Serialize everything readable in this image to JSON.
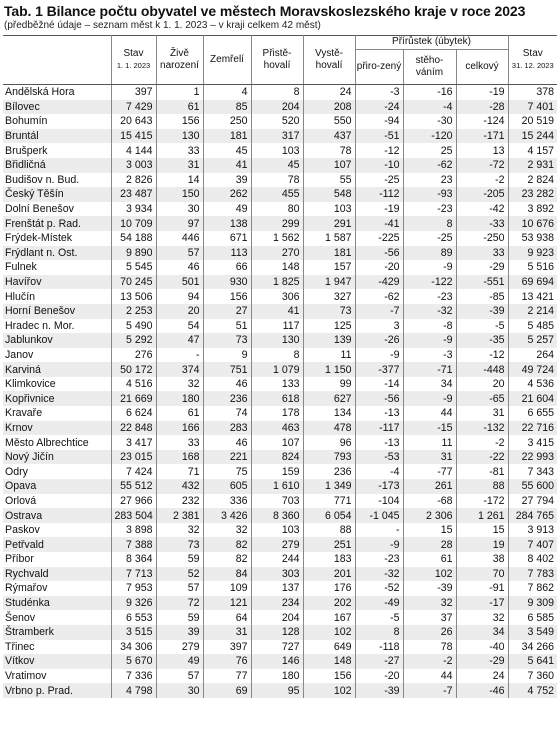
{
  "title": "Tab. 1 Bilance počtu obyvatel ve městech Moravskoslezského kraje v roce 2023",
  "subtitle": "(předběžné údaje – seznam měst k 1. 1. 2023 – v kraji celkem 42 měst)",
  "headers": {
    "stav_start": "Stav",
    "stav_start_date": "1. 1. 2023",
    "zive_narozeni": "Živě narození",
    "zemreli": "Zemřelí",
    "pristehovali": "Přistě-hovalí",
    "vystehovali": "Vystě-hovalí",
    "prirustek": "Přírůstek (úbytek)",
    "prirozeny": "přiro-zený",
    "stehovanim": "stěho-váním",
    "celkovy": "celkový",
    "stav_end": "Stav",
    "stav_end_date": "31. 12. 2023"
  },
  "rows": [
    [
      "Andělská Hora",
      "397",
      "1",
      "4",
      "8",
      "24",
      "-3",
      "-16",
      "-19",
      "378"
    ],
    [
      "Bílovec",
      "7 429",
      "61",
      "85",
      "204",
      "208",
      "-24",
      "-4",
      "-28",
      "7 401"
    ],
    [
      "Bohumín",
      "20 643",
      "156",
      "250",
      "520",
      "550",
      "-94",
      "-30",
      "-124",
      "20 519"
    ],
    [
      "Bruntál",
      "15 415",
      "130",
      "181",
      "317",
      "437",
      "-51",
      "-120",
      "-171",
      "15 244"
    ],
    [
      "Brušperk",
      "4 144",
      "33",
      "45",
      "103",
      "78",
      "-12",
      "25",
      "13",
      "4 157"
    ],
    [
      "Břidličná",
      "3 003",
      "31",
      "41",
      "45",
      "107",
      "-10",
      "-62",
      "-72",
      "2 931"
    ],
    [
      "Budišov n. Bud.",
      "2 826",
      "14",
      "39",
      "78",
      "55",
      "-25",
      "23",
      "-2",
      "2 824"
    ],
    [
      "Český Těšín",
      "23 487",
      "150",
      "262",
      "455",
      "548",
      "-112",
      "-93",
      "-205",
      "23 282"
    ],
    [
      "Dolní Benešov",
      "3 934",
      "30",
      "49",
      "80",
      "103",
      "-19",
      "-23",
      "-42",
      "3 892"
    ],
    [
      "Frenštát p. Rad.",
      "10 709",
      "97",
      "138",
      "299",
      "291",
      "-41",
      "8",
      "-33",
      "10 676"
    ],
    [
      "Frýdek-Místek",
      "54 188",
      "446",
      "671",
      "1 562",
      "1 587",
      "-225",
      "-25",
      "-250",
      "53 938"
    ],
    [
      "Frýdlant n. Ost.",
      "9 890",
      "57",
      "113",
      "270",
      "181",
      "-56",
      "89",
      "33",
      "9 923"
    ],
    [
      "Fulnek",
      "5 545",
      "46",
      "66",
      "148",
      "157",
      "-20",
      "-9",
      "-29",
      "5 516"
    ],
    [
      "Havířov",
      "70 245",
      "501",
      "930",
      "1 825",
      "1 947",
      "-429",
      "-122",
      "-551",
      "69 694"
    ],
    [
      "Hlučín",
      "13 506",
      "94",
      "156",
      "306",
      "327",
      "-62",
      "-23",
      "-85",
      "13 421"
    ],
    [
      "Horní Benešov",
      "2 253",
      "20",
      "27",
      "41",
      "73",
      "-7",
      "-32",
      "-39",
      "2 214"
    ],
    [
      "Hradec n. Mor.",
      "5 490",
      "54",
      "51",
      "117",
      "125",
      "3",
      "-8",
      "-5",
      "5 485"
    ],
    [
      "Jablunkov",
      "5 292",
      "47",
      "73",
      "130",
      "139",
      "-26",
      "-9",
      "-35",
      "5 257"
    ],
    [
      "Janov",
      "276",
      "-",
      "9",
      "8",
      "11",
      "-9",
      "-3",
      "-12",
      "264"
    ],
    [
      "Karviná",
      "50 172",
      "374",
      "751",
      "1 079",
      "1 150",
      "-377",
      "-71",
      "-448",
      "49 724"
    ],
    [
      "Klimkovice",
      "4 516",
      "32",
      "46",
      "133",
      "99",
      "-14",
      "34",
      "20",
      "4 536"
    ],
    [
      "Kopřivnice",
      "21 669",
      "180",
      "236",
      "618",
      "627",
      "-56",
      "-9",
      "-65",
      "21 604"
    ],
    [
      "Kravaře",
      "6 624",
      "61",
      "74",
      "178",
      "134",
      "-13",
      "44",
      "31",
      "6 655"
    ],
    [
      "Krnov",
      "22 848",
      "166",
      "283",
      "463",
      "478",
      "-117",
      "-15",
      "-132",
      "22 716"
    ],
    [
      "Město Albrechtice",
      "3 417",
      "33",
      "46",
      "107",
      "96",
      "-13",
      "11",
      "-2",
      "3 415"
    ],
    [
      "Nový Jičín",
      "23 015",
      "168",
      "221",
      "824",
      "793",
      "-53",
      "31",
      "-22",
      "22 993"
    ],
    [
      "Odry",
      "7 424",
      "71",
      "75",
      "159",
      "236",
      "-4",
      "-77",
      "-81",
      "7 343"
    ],
    [
      "Opava",
      "55 512",
      "432",
      "605",
      "1 610",
      "1 349",
      "-173",
      "261",
      "88",
      "55 600"
    ],
    [
      "Orlová",
      "27 966",
      "232",
      "336",
      "703",
      "771",
      "-104",
      "-68",
      "-172",
      "27 794"
    ],
    [
      "Ostrava",
      "283 504",
      "2 381",
      "3 426",
      "8 360",
      "6 054",
      "-1 045",
      "2 306",
      "1 261",
      "284 765"
    ],
    [
      "Paskov",
      "3 898",
      "32",
      "32",
      "103",
      "88",
      "-",
      "15",
      "15",
      "3 913"
    ],
    [
      "Petřvald",
      "7 388",
      "73",
      "82",
      "279",
      "251",
      "-9",
      "28",
      "19",
      "7 407"
    ],
    [
      "Příbor",
      "8 364",
      "59",
      "82",
      "244",
      "183",
      "-23",
      "61",
      "38",
      "8 402"
    ],
    [
      "Rychvald",
      "7 713",
      "52",
      "84",
      "303",
      "201",
      "-32",
      "102",
      "70",
      "7 783"
    ],
    [
      "Rýmařov",
      "7 953",
      "57",
      "109",
      "137",
      "176",
      "-52",
      "-39",
      "-91",
      "7 862"
    ],
    [
      "Studénka",
      "9 326",
      "72",
      "121",
      "234",
      "202",
      "-49",
      "32",
      "-17",
      "9 309"
    ],
    [
      "Šenov",
      "6 553",
      "59",
      "64",
      "204",
      "167",
      "-5",
      "37",
      "32",
      "6 585"
    ],
    [
      "Štramberk",
      "3 515",
      "39",
      "31",
      "128",
      "102",
      "8",
      "26",
      "34",
      "3 549"
    ],
    [
      "Třinec",
      "34 306",
      "279",
      "397",
      "727",
      "649",
      "-118",
      "78",
      "-40",
      "34 266"
    ],
    [
      "Vítkov",
      "5 670",
      "49",
      "76",
      "146",
      "148",
      "-27",
      "-2",
      "-29",
      "5 641"
    ],
    [
      "Vratimov",
      "7 336",
      "57",
      "77",
      "180",
      "156",
      "-20",
      "44",
      "24",
      "7 360"
    ],
    [
      "Vrbno p. Prad.",
      "4 798",
      "30",
      "69",
      "95",
      "102",
      "-39",
      "-7",
      "-46",
      "4 752"
    ]
  ]
}
